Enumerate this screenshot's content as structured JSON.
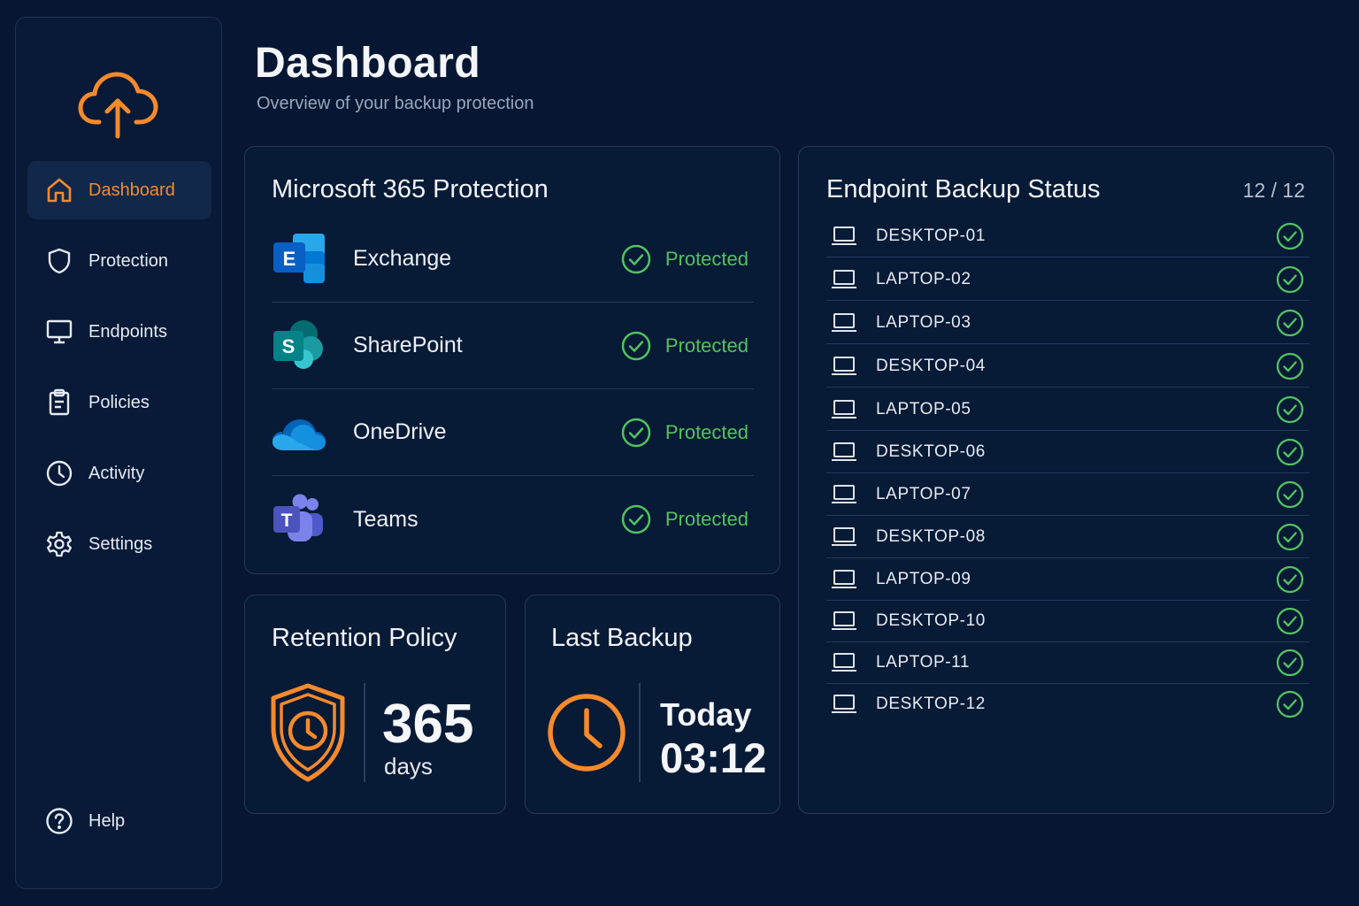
{
  "header": {
    "title": "Dashboard",
    "subtitle": "Overview of your backup protection"
  },
  "sidebar": {
    "logo_icon": "cloud-upload-icon",
    "accent_color": "#f58a2c",
    "items": [
      {
        "label": "Dashboard",
        "icon": "home-icon",
        "active": true
      },
      {
        "label": "Protection",
        "icon": "shield-icon",
        "active": false
      },
      {
        "label": "Endpoints",
        "icon": "monitor-icon",
        "active": false
      },
      {
        "label": "Policies",
        "icon": "clipboard-icon",
        "active": false
      },
      {
        "label": "Activity",
        "icon": "clock-icon",
        "active": false
      },
      {
        "label": "Settings",
        "icon": "gear-icon",
        "active": false
      }
    ],
    "help": {
      "label": "Help",
      "icon": "help-circle-icon"
    }
  },
  "m365": {
    "title": "Microsoft 365 Protection",
    "status_color": "#52c35f",
    "apps": [
      {
        "name": "Exchange",
        "icon": "exchange-icon",
        "status": "Protected"
      },
      {
        "name": "SharePoint",
        "icon": "sharepoint-icon",
        "status": "Protected"
      },
      {
        "name": "OneDrive",
        "icon": "onedrive-icon",
        "status": "Protected"
      },
      {
        "name": "Teams",
        "icon": "teams-icon",
        "status": "Protected"
      }
    ]
  },
  "retention": {
    "title": "Retention Policy",
    "value": "365",
    "unit": "days",
    "icon": "shield-clock-icon"
  },
  "last_backup": {
    "title": "Last Backup",
    "day": "Today",
    "time": "03:12",
    "icon": "clock-icon"
  },
  "endpoints": {
    "title": "Endpoint Backup Status",
    "count": "12 / 12",
    "items": [
      {
        "name": "DESKTOP-01",
        "icon": "laptop-icon",
        "status": "ok"
      },
      {
        "name": "LAPTOP-02",
        "icon": "laptop-icon",
        "status": "ok"
      },
      {
        "name": "LAPTOP-03",
        "icon": "laptop-icon",
        "status": "ok"
      },
      {
        "name": "DESKTOP-04",
        "icon": "laptop-icon",
        "status": "ok"
      },
      {
        "name": "LAPTOP-05",
        "icon": "laptop-icon",
        "status": "ok"
      },
      {
        "name": "DESKTOP-06",
        "icon": "laptop-icon",
        "status": "ok"
      },
      {
        "name": "LAPTOP-07",
        "icon": "laptop-icon",
        "status": "ok"
      },
      {
        "name": "DESKTOP-08",
        "icon": "laptop-icon",
        "status": "ok"
      },
      {
        "name": "LAPTOP-09",
        "icon": "laptop-icon",
        "status": "ok"
      },
      {
        "name": "DESKTOP-10",
        "icon": "laptop-icon",
        "status": "ok"
      },
      {
        "name": "LAPTOP-11",
        "icon": "laptop-icon",
        "status": "ok"
      },
      {
        "name": "DESKTOP-12",
        "icon": "laptop-icon",
        "status": "ok"
      }
    ]
  }
}
